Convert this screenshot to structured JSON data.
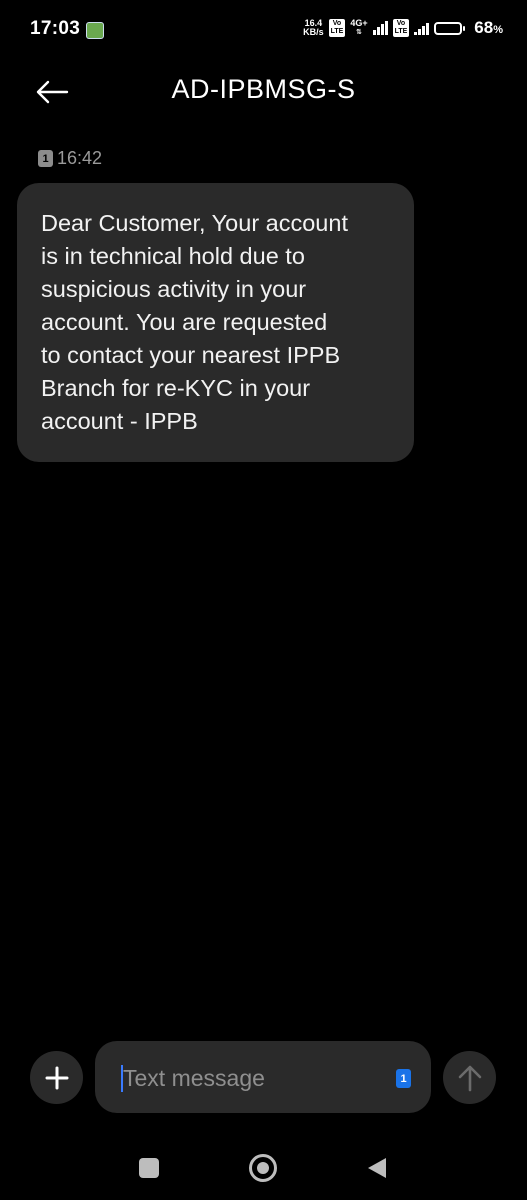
{
  "status_bar": {
    "time": "17:03",
    "net_speed_value": "16.4",
    "net_speed_unit": "KB/s",
    "volte_1": "Vo\nLTE",
    "network_type": "4G+",
    "volte_2": "Vo\nLTE",
    "battery_percent": "68",
    "battery_percent_sign": "%",
    "battery_level": 0.68
  },
  "header": {
    "title": "AD-IPBMSG-S",
    "back_icon": "arrow-left-icon"
  },
  "conversation": {
    "messages": [
      {
        "sim": "1",
        "time": "16:42",
        "text": "Dear Customer, Your account\nis in technical hold due to\nsuspicious activity in your\naccount. You are requested\nto contact your nearest IPPB\nBranch for re-KYC in your\naccount - IPPB"
      }
    ]
  },
  "composer": {
    "add_icon": "plus-icon",
    "placeholder": "Text message",
    "sim": "1",
    "send_icon": "arrow-up-icon"
  },
  "nav_bar": {
    "recents_icon": "square-icon",
    "home_icon": "circle-icon",
    "back_icon": "triangle-back-icon"
  }
}
